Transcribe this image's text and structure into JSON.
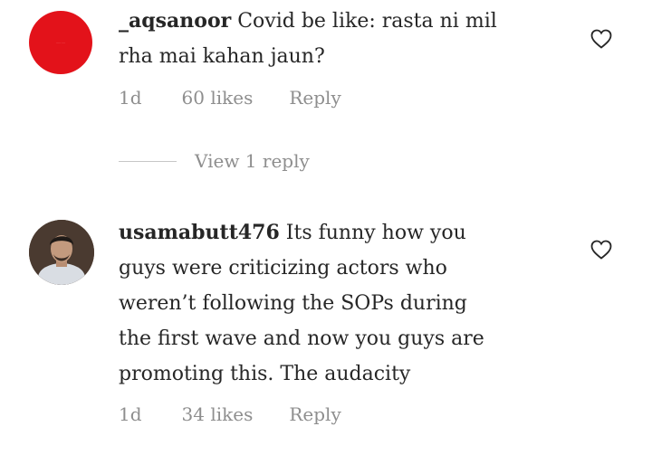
{
  "comments": [
    {
      "username": "_aqsanoor",
      "text": "Covid be like: rasta ni mil rha mai kahan jaun?",
      "line1": "Covid be like: rasta ni mil",
      "line2": "rha mai kahan jaun?",
      "time": "1d",
      "likes": "60 likes",
      "reply": "Reply",
      "view_replies": "View 1 reply"
    },
    {
      "username": "usamabutt476",
      "text": "Its funny how you guys were criticizing actors who weren’t following the SOPs during the first wave and now you guys are promoting this. The audacity",
      "line1": "Its funny how you",
      "line2": "guys were criticizing actors who",
      "line3": "weren’t following the SOPs during",
      "line4": "the first wave and now you guys are",
      "line5": "promoting this. The audacity",
      "time": "1d",
      "likes": "34 likes",
      "reply": "Reply"
    }
  ],
  "colors": {
    "text": "#262626",
    "secondary": "#8e8e8e",
    "avatar_red": "#e3121a"
  },
  "icons": [
    "heart-icon",
    "heart-icon"
  ]
}
